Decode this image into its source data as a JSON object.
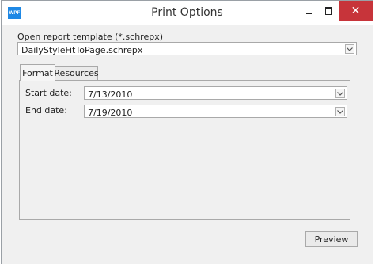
{
  "window": {
    "title": "Print Options",
    "app_icon_text": "WPF"
  },
  "template": {
    "label": "Open report template (*.schrepx)",
    "value": "DailyStyleFitToPage.schrepx"
  },
  "tabs": [
    {
      "label": "Format",
      "selected": true
    },
    {
      "label": "Resources",
      "selected": false
    }
  ],
  "format": {
    "start_label": "Start date:",
    "start_value": "7/13/2010",
    "end_label": "End date:",
    "end_value": "7/19/2010"
  },
  "actions": {
    "preview_label": "Preview"
  },
  "colors": {
    "close_button": "#c7343a",
    "app_icon": "#1e88e5"
  }
}
